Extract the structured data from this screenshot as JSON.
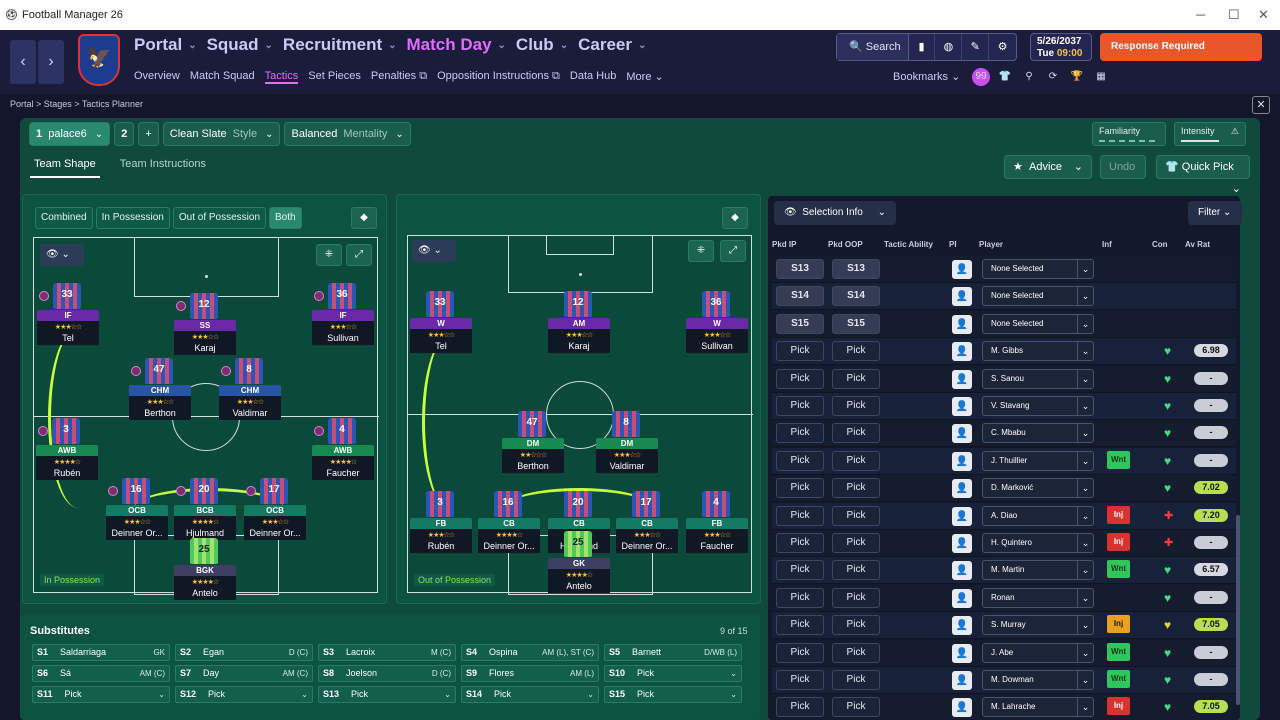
{
  "window": {
    "title": "Football Manager 26",
    "icon": "football-icon"
  },
  "nav": {
    "main": [
      {
        "label": "Portal",
        "active": false
      },
      {
        "label": "Squad",
        "active": false
      },
      {
        "label": "Recruitment",
        "active": false
      },
      {
        "label": "Match Day",
        "active": true
      },
      {
        "label": "Club",
        "active": false
      },
      {
        "label": "Career",
        "active": false
      }
    ],
    "sub": [
      {
        "label": "Overview",
        "active": false
      },
      {
        "label": "Match Squad",
        "active": false
      },
      {
        "label": "Tactics",
        "active": true
      },
      {
        "label": "Set Pieces",
        "active": false
      },
      {
        "label": "Penalties",
        "active": false,
        "ext": true
      },
      {
        "label": "Opposition Instructions",
        "active": false,
        "ext": true
      },
      {
        "label": "Data Hub",
        "active": false
      },
      {
        "label": "More",
        "active": false
      }
    ],
    "search_label": "Search",
    "date": "5/26/2037",
    "day": "Tue",
    "time": "09:00",
    "response_label": "Response Required",
    "bookmarks_label": "Bookmarks",
    "notif_count": "99"
  },
  "breadcrumb": {
    "items": [
      "Portal",
      "Stages",
      "Tactics Planner"
    ]
  },
  "tactic": {
    "slot1_num": "1",
    "slot1_name": "palace6",
    "slot2_num": "2",
    "style_value": "Clean Slate",
    "style_label": "Style",
    "mentality_value": "Balanced",
    "mentality_label": "Mentality",
    "familiarity_label": "Familiarity",
    "intensity_label": "Intensity"
  },
  "tabs": {
    "team_shape": "Team Shape",
    "team_instructions": "Team Instructions"
  },
  "actions": {
    "advice": "Advice",
    "undo": "Undo",
    "quick_pick": "Quick Pick"
  },
  "view_tabs": [
    "Combined",
    "In Possession",
    "Out of Possession",
    "Both"
  ],
  "pitch_labels": {
    "in": "In Possession",
    "out": "Out of Possession"
  },
  "in_possession": [
    {
      "num": "33",
      "role": "IF",
      "name": "Tel",
      "stars": "★★★☆☆"
    },
    {
      "num": "12",
      "role": "SS",
      "name": "Karaj",
      "stars": "★★★☆☆"
    },
    {
      "num": "36",
      "role": "IF",
      "name": "Sullivan",
      "stars": "★★★☆☆"
    },
    {
      "num": "47",
      "role": "CHM",
      "name": "Berthon",
      "stars": "★★★☆☆"
    },
    {
      "num": "8",
      "role": "CHM",
      "name": "Valdimar",
      "stars": "★★★☆☆"
    },
    {
      "num": "3",
      "role": "AWB",
      "name": "Rubén",
      "stars": "★★★★☆"
    },
    {
      "num": "4",
      "role": "AWB",
      "name": "Faucher",
      "stars": "★★★★☆"
    },
    {
      "num": "16",
      "role": "OCB",
      "name": "Deinner Or...",
      "stars": "★★★☆☆"
    },
    {
      "num": "20",
      "role": "BCB",
      "name": "Hjulmand",
      "stars": "★★★★☆"
    },
    {
      "num": "17",
      "role": "OCB",
      "name": "Deinner Or...",
      "stars": "★★★☆☆"
    },
    {
      "num": "25",
      "role": "BGK",
      "name": "Antelo",
      "stars": "★★★★☆"
    }
  ],
  "out_possession": [
    {
      "num": "33",
      "role": "W",
      "name": "Tel",
      "stars": "★★★☆☆"
    },
    {
      "num": "12",
      "role": "AM",
      "name": "Karaj",
      "stars": "★★★☆☆"
    },
    {
      "num": "36",
      "role": "W",
      "name": "Sullivan",
      "stars": "★★★☆☆"
    },
    {
      "num": "47",
      "role": "DM",
      "name": "Berthon",
      "stars": "★★☆☆☆"
    },
    {
      "num": "8",
      "role": "DM",
      "name": "Valdimar",
      "stars": "★★★☆☆"
    },
    {
      "num": "3",
      "role": "FB",
      "name": "Rubén",
      "stars": "★★★☆☆"
    },
    {
      "num": "16",
      "role": "CB",
      "name": "Deinner Or...",
      "stars": "★★★★☆"
    },
    {
      "num": "20",
      "role": "CB",
      "name": "Hjulmand",
      "stars": "★★★★☆"
    },
    {
      "num": "17",
      "role": "CB",
      "name": "Deinner Or...",
      "stars": "★★★☆☆"
    },
    {
      "num": "4",
      "role": "FB",
      "name": "Faucher",
      "stars": "★★★☆☆"
    },
    {
      "num": "25",
      "role": "GK",
      "name": "Antelo",
      "stars": "★★★★☆"
    }
  ],
  "subs": {
    "title": "Substitutes",
    "count": "9 of 15",
    "items": [
      {
        "slot": "S1",
        "name": "Saldarriaga",
        "pos": "GK"
      },
      {
        "slot": "S2",
        "name": "Egan",
        "pos": "D (C)"
      },
      {
        "slot": "S3",
        "name": "Lacroix",
        "pos": "M (C)"
      },
      {
        "slot": "S4",
        "name": "Ospina",
        "pos": "AM (L), ST (C)"
      },
      {
        "slot": "S5",
        "name": "Barnett",
        "pos": "D/WB (L)"
      },
      {
        "slot": "S6",
        "name": "Sá",
        "pos": "AM (C)"
      },
      {
        "slot": "S7",
        "name": "Day",
        "pos": "AM (C)"
      },
      {
        "slot": "S8",
        "name": "Joelson",
        "pos": "D (C)"
      },
      {
        "slot": "S9",
        "name": "Flores",
        "pos": "AM (L)"
      },
      {
        "slot": "S10",
        "name": "Pick",
        "pos": "⌄"
      },
      {
        "slot": "S11",
        "name": "Pick",
        "pos": "⌄"
      },
      {
        "slot": "S12",
        "name": "Pick",
        "pos": "⌄"
      },
      {
        "slot": "S13",
        "name": "Pick",
        "pos": "⌄"
      },
      {
        "slot": "S14",
        "name": "Pick",
        "pos": "⌄"
      },
      {
        "slot": "S15",
        "name": "Pick",
        "pos": "⌄"
      }
    ]
  },
  "selection": {
    "info_label": "Selection Info",
    "filter_label": "Filter",
    "headers": [
      "Pkd IP",
      "Pkd OOP",
      "Tactic Ability",
      "PI",
      "Player",
      "Inf",
      "Con",
      "Av Rat"
    ],
    "rows": [
      {
        "ip": "S13",
        "oop": "S13",
        "player": "None Selected",
        "inf": "",
        "con": "",
        "rat": ""
      },
      {
        "ip": "S14",
        "oop": "S14",
        "player": "None Selected",
        "inf": "",
        "con": "",
        "rat": ""
      },
      {
        "ip": "S15",
        "oop": "S15",
        "player": "None Selected",
        "inf": "",
        "con": "",
        "rat": ""
      },
      {
        "ip": "Pick",
        "oop": "Pick",
        "player": "M. Gibbs",
        "inf": "",
        "con": "g",
        "rat": "6.98"
      },
      {
        "ip": "Pick",
        "oop": "Pick",
        "player": "S. Sanou",
        "inf": "",
        "con": "g",
        "rat": "-"
      },
      {
        "ip": "Pick",
        "oop": "Pick",
        "player": "V. Stavang",
        "inf": "",
        "con": "g",
        "rat": "-"
      },
      {
        "ip": "Pick",
        "oop": "Pick",
        "player": "C. Mbabu",
        "inf": "",
        "con": "g",
        "rat": "-"
      },
      {
        "ip": "Pick",
        "oop": "Pick",
        "player": "J. Thuillier",
        "inf": "Wnt",
        "con": "g",
        "rat": "-"
      },
      {
        "ip": "Pick",
        "oop": "Pick",
        "player": "D. Marković",
        "inf": "",
        "con": "g",
        "rat": "7.02"
      },
      {
        "ip": "Pick",
        "oop": "Pick",
        "player": "A. Diao",
        "inf": "Inj",
        "con": "r",
        "rat": "7.20"
      },
      {
        "ip": "Pick",
        "oop": "Pick",
        "player": "H. Quintero",
        "inf": "Inj",
        "con": "r",
        "rat": "-"
      },
      {
        "ip": "Pick",
        "oop": "Pick",
        "player": "M. Martin",
        "inf": "Wnt",
        "con": "g",
        "rat": "6.57"
      },
      {
        "ip": "Pick",
        "oop": "Pick",
        "player": "Ronan",
        "inf": "",
        "con": "g",
        "rat": "-"
      },
      {
        "ip": "Pick",
        "oop": "Pick",
        "player": "S. Murray",
        "inf": "Inj",
        "con": "y",
        "rat": "7.05"
      },
      {
        "ip": "Pick",
        "oop": "Pick",
        "player": "J. Abe",
        "inf": "Wnt",
        "con": "g",
        "rat": "-"
      },
      {
        "ip": "Pick",
        "oop": "Pick",
        "player": "M. Dowman",
        "inf": "Wnt",
        "con": "g",
        "rat": "-"
      },
      {
        "ip": "Pick",
        "oop": "Pick",
        "player": "M. Lahrache",
        "inf": "Inj",
        "con": "g",
        "rat": "7.05"
      }
    ]
  },
  "colors": {
    "accent": "#e36bff",
    "response": "#e8562a",
    "panel": "#0f4a3c",
    "wanted": "#2fc65c",
    "injured": "#d8332e"
  }
}
